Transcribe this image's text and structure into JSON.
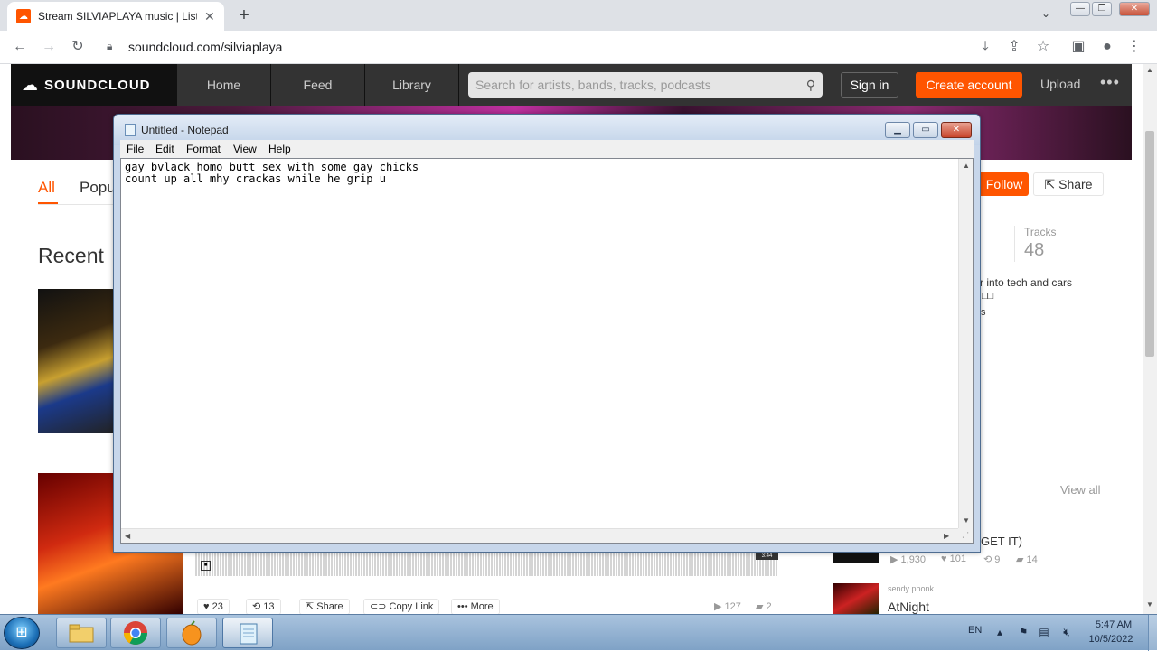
{
  "browser": {
    "tab_title": "Stream SILVIAPLAYA music | Liste",
    "tab_close": "✕",
    "new_tab": "+",
    "url": "soundcloud.com/silviaplaya",
    "icons": [
      "back-icon",
      "forward-icon",
      "reload-icon",
      "lock-icon",
      "download-icon",
      "share-icon",
      "star-icon",
      "sidepanel-icon",
      "profile-icon",
      "menu-icon"
    ]
  },
  "soundcloud": {
    "logo": "SOUNDCLOUD",
    "nav": [
      "Home",
      "Feed",
      "Library"
    ],
    "search_placeholder": "Search for artists, bands, tracks, podcasts",
    "sign_in": "Sign in",
    "create_account": "Create account",
    "upload": "Upload",
    "more": "•••",
    "tabs": [
      "All",
      "Popu"
    ],
    "recent": "Recent",
    "follow": "Follow",
    "share": "Share",
    "tracks_label": "Tracks",
    "tracks_count": "48",
    "bio_line1": "r into tech and cars",
    "bio_line2": "□□",
    "bio_line3": "s",
    "view_all": "View all",
    "side_track1_title": "GET IT)",
    "side_track1_plays": "1,930",
    "side_track1_likes": "101",
    "side_track1_reposts": "9",
    "side_track1_comments": "14",
    "side_track2_user": "sendy phonk",
    "side_track2_title": "AtNight",
    "wave_time": "3:44",
    "likes": "23",
    "reposts": "13",
    "share_btn": "Share",
    "copy_link": "Copy Link",
    "more_btn": "More",
    "plays": "127",
    "comments": "2",
    "accent": "#ff5500"
  },
  "notepad": {
    "title": "Untitled - Notepad",
    "menu": [
      "File",
      "Edit",
      "Format",
      "View",
      "Help"
    ],
    "text": "gay bvlack homo butt sex with some gay chicks\ncount up all mhy crackas while he grip u"
  },
  "taskbar": {
    "language": "EN",
    "time": "5:47 AM",
    "date": "10/5/2022",
    "apps": [
      "explorer-icon",
      "chrome-icon",
      "fl-studio-icon",
      "notepad-icon"
    ]
  }
}
